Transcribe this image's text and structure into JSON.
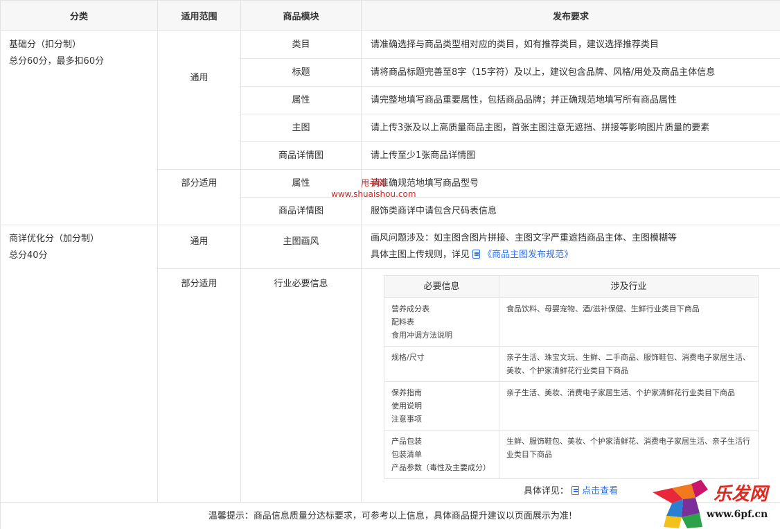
{
  "headers": [
    "分类",
    "适用范围",
    "商品模块",
    "发布要求"
  ],
  "basic": {
    "category_line1": "基础分（扣分制）",
    "category_line2": "总分60分，最多扣60分",
    "general_scope": "通用",
    "partial_scope": "部分适用",
    "rows": [
      {
        "module": "类目",
        "requirement": "请准确选择与商品类型相对应的类目，如有推荐类目，建议选择推荐类目"
      },
      {
        "module": "标题",
        "requirement": "请将商品标题完善至8字（15字符）及以上，建议包含品牌、风格/用处及商品主体信息"
      },
      {
        "module": "属性",
        "requirement": "请完整地填写商品重要属性，包括商品品牌；并正确规范地填写所有商品属性"
      },
      {
        "module": "主图",
        "requirement": "请上传3张及以上高质量商品主图，首张主图注意无遮挡、拼接等影响图片质量的要素"
      },
      {
        "module": "商品详情图",
        "requirement": "请上传至少1张商品详情图"
      }
    ],
    "partial_rows": [
      {
        "module": "属性",
        "requirement": "请准确规范地填写商品型号"
      },
      {
        "module": "商品详情图",
        "requirement": "服饰类商详中请包含尺码表信息"
      }
    ]
  },
  "optimize": {
    "category_line1": "商详优化分（加分制）",
    "category_line2": "总分40分",
    "general_scope": "通用",
    "general_module": "主图画风",
    "general_req_line1": "画风问题涉及：如主图含图片拼接、主图文字严重遮挡商品主体、主图模糊等",
    "general_req_line2": "具体主图上传规则，详见",
    "general_req_link": "《商品主图发布规范》",
    "partial_scope": "部分适用",
    "partial_module": "行业必要信息",
    "sub_headers": [
      "必要信息",
      "涉及行业"
    ],
    "sub_rows": [
      {
        "info": [
          "营养成分表",
          "配料表",
          "食用冲调方法说明"
        ],
        "industry": "食品饮料、母婴宠物、酒/滋补保健、生鲜行业类目下商品"
      },
      {
        "info": [
          "规格/尺寸"
        ],
        "industry": "亲子生活、珠宝文玩、生鲜、二手商品、服饰鞋包、消费电子家居生活、美妆、个护家清鲜花行业类目下商品"
      },
      {
        "info": [
          "保养指南",
          "使用说明",
          "注意事项"
        ],
        "industry": "亲子生活、美妆、消费电子家居生活、个护家清鲜花行业类目下商品"
      },
      {
        "info": [
          "产品包装",
          "包装清单",
          "产品参数（毒性及主要成分）"
        ],
        "industry": "生鲜、服饰鞋包、美妆、个护家清鲜花、消费电子家居生活、亲子生活行业类目下商品"
      }
    ],
    "detail_label": "具体详见：",
    "detail_link": "点击查看"
  },
  "footer": "温馨提示：商品信息质量分达标要求，可参考以上信息，具体商品提升建议以页面展示为准!",
  "watermarks": {
    "site_name": "甩手网",
    "site_url": "www.shuaishou.com",
    "logo_text": "乐发网",
    "logo_url": "www.6pf.cn"
  },
  "colors": {
    "link": "#2f6fe4",
    "header_bg": "#f7f7f7",
    "border": "#e3e3e3",
    "watermark_red": "#e02020"
  }
}
